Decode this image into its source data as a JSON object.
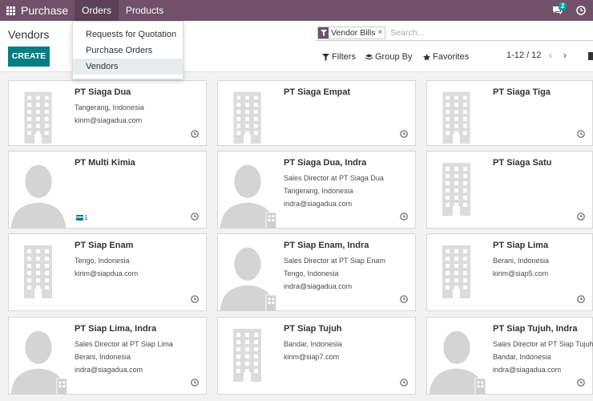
{
  "navbar": {
    "app_name": "Purchase",
    "menus": [
      "Orders",
      "Products"
    ],
    "chat_count": "2",
    "background": "#71506a"
  },
  "control": {
    "title": "Vendors",
    "create_label": "CREATE",
    "facet_label": "Vendor Bills",
    "facet_close": "×",
    "search_placeholder": "Search...",
    "filters_label": "Filters",
    "groupby_label": "Group By",
    "favorites_label": "Favorites",
    "pager": "1-12 / 12",
    "prev": "‹",
    "next": "›"
  },
  "dropdown": {
    "items": [
      "Requests for Quotation",
      "Purchase Orders",
      "Vendors"
    ],
    "selected": "Vendors"
  },
  "cards": [
    {
      "title": "PT Siaga Dua",
      "lines": [
        "Tangerang, Indonesia",
        "kirim@siagadua.com"
      ],
      "image": "company-icon"
    },
    {
      "title": "PT Siaga Empat",
      "lines": [],
      "image": "company-icon"
    },
    {
      "title": "PT Siaga Tiga",
      "lines": [],
      "image": "company-icon"
    },
    {
      "title": "PT Multi Kimia",
      "lines": [],
      "image": "person-icon",
      "bank_count": "1"
    },
    {
      "title": "PT Siaga Dua, Indra",
      "lines": [
        "Sales Director at PT Siaga Dua",
        "Tangerang, Indonesia",
        "indra@siagadua.com"
      ],
      "image": "contact-icon"
    },
    {
      "title": "PT Siaga Satu",
      "lines": [],
      "image": "company-icon"
    },
    {
      "title": "PT Siap Enam",
      "lines": [
        "Tengo, Indonesia",
        "kirim@siapdua.com"
      ],
      "image": "company-icon"
    },
    {
      "title": "PT Siap Enam, Indra",
      "lines": [
        "Sales Director at PT Siap Enam",
        "Tengo, Indonesia",
        "indra@siagadua.com"
      ],
      "image": "contact-icon"
    },
    {
      "title": "PT Siap Lima",
      "lines": [
        "Berani, Indonesia",
        "kirim@siap5.com"
      ],
      "image": "company-icon"
    },
    {
      "title": "PT Siap Lima, Indra",
      "lines": [
        "Sales Director at PT Siap Lima",
        "Berani, Indonesia",
        "indra@siagadua.com"
      ],
      "image": "contact-icon"
    },
    {
      "title": "PT Siap Tujuh",
      "lines": [
        "Bandar, Indonesia",
        "kirim@siap7.com"
      ],
      "image": "company-icon"
    },
    {
      "title": "PT Siap Tujuh, Indra",
      "lines": [
        "Sales Director at PT Siap Tujuh",
        "Bandar, Indonesia",
        "indra@siagadua.com"
      ],
      "image": "contact-icon"
    }
  ]
}
